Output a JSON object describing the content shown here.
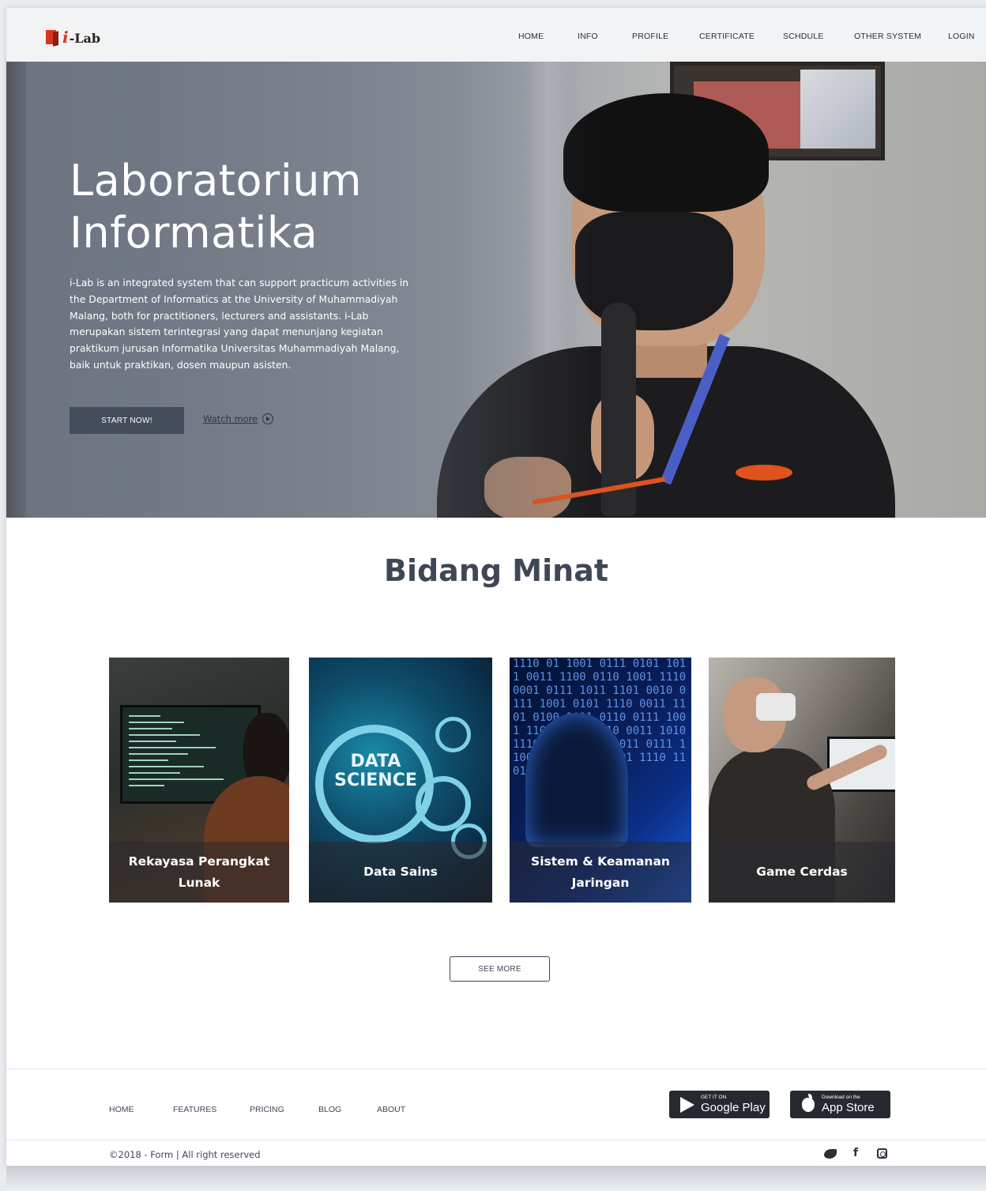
{
  "header": {
    "logo_text": "-Lab",
    "logo_i": "i",
    "nav": [
      "HOME",
      "INFO",
      "PROFILE",
      "CERTIFICATE",
      "SCHDULE",
      "OTHER SYSTEM",
      "LOGIN"
    ]
  },
  "hero": {
    "title_line1": "Laboratorium",
    "title_line2": "Informatika",
    "description": "i-Lab is an integrated system that can support practicum activities in the Department of Informatics at the University of Muhammadiyah Malang, both for practitioners, lecturers and assistants. i-Lab merupakan sistem terintegrasi yang dapat menunjang kegiatan praktikum jurusan Informatika Universitas Muhammadiyah Malang, baik untuk praktikan, dosen maupun asisten.",
    "start_button": "START NOW!",
    "watch_more": "Watch more"
  },
  "section": {
    "title": "Bidang Minat",
    "cards": [
      {
        "label": "Rekayasa Perangkat Lunak"
      },
      {
        "label": "Data Sains"
      },
      {
        "label": "Sistem & Keamanan Jaringan"
      },
      {
        "label": "Game Cerdas"
      }
    ],
    "card2_image_text": "DATA SCIENCE",
    "see_more": "SEE MORE"
  },
  "footer": {
    "nav": [
      "HOME",
      "FEATURES",
      "PRICING",
      "BLOG",
      "ABOUT"
    ],
    "google_play": {
      "small": "GET IT ON",
      "big": "Google Play"
    },
    "app_store": {
      "small": "Download on the",
      "big": "App Store"
    },
    "copyright": "©2018 - Form  |   All right reserved",
    "facebook_glyph": "f"
  },
  "colors": {
    "accent": "#d9351f",
    "dark_button": "#454d5c",
    "heading": "#3f4757"
  }
}
